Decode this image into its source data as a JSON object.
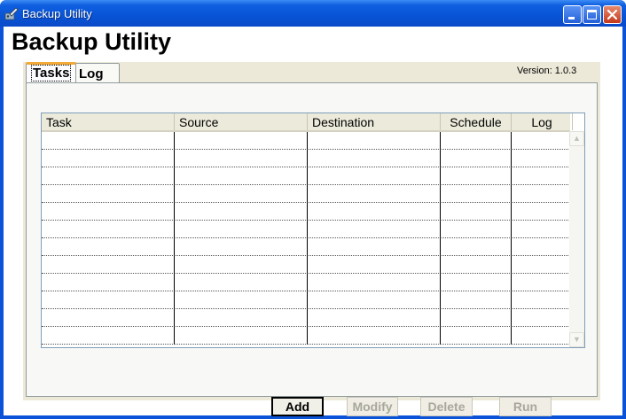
{
  "window": {
    "title": "Backup Utility"
  },
  "app": {
    "heading": "Backup Utility",
    "version": "Version: 1.0.3"
  },
  "tabs": [
    {
      "label": "Tasks",
      "selected": true
    },
    {
      "label": "Log",
      "selected": false
    }
  ],
  "tasks_table": {
    "columns": [
      "Task",
      "Source",
      "Destination",
      "Schedule",
      "Log"
    ],
    "rows": [
      [
        "",
        "",
        "",
        "",
        ""
      ],
      [
        "",
        "",
        "",
        "",
        ""
      ],
      [
        "",
        "",
        "",
        "",
        ""
      ],
      [
        "",
        "",
        "",
        "",
        ""
      ],
      [
        "",
        "",
        "",
        "",
        ""
      ],
      [
        "",
        "",
        "",
        "",
        ""
      ],
      [
        "",
        "",
        "",
        "",
        ""
      ],
      [
        "",
        "",
        "",
        "",
        ""
      ],
      [
        "",
        "",
        "",
        "",
        ""
      ],
      [
        "",
        "",
        "",
        "",
        ""
      ],
      [
        "",
        "",
        "",
        "",
        ""
      ],
      [
        "",
        "",
        "",
        "",
        ""
      ]
    ]
  },
  "buttons": {
    "add": "Add",
    "modify": "Modify",
    "delete": "Delete",
    "run": "Run"
  },
  "colors": {
    "title_bar": "#0a52d8",
    "tab_highlight": "#f3a937",
    "panel_background": "#ece9d8",
    "disabled_text": "#a8a79c"
  },
  "icons": [
    "backup-app-icon",
    "minimize-icon",
    "maximize-icon",
    "close-icon",
    "scroll-up-icon",
    "scroll-down-icon"
  ]
}
